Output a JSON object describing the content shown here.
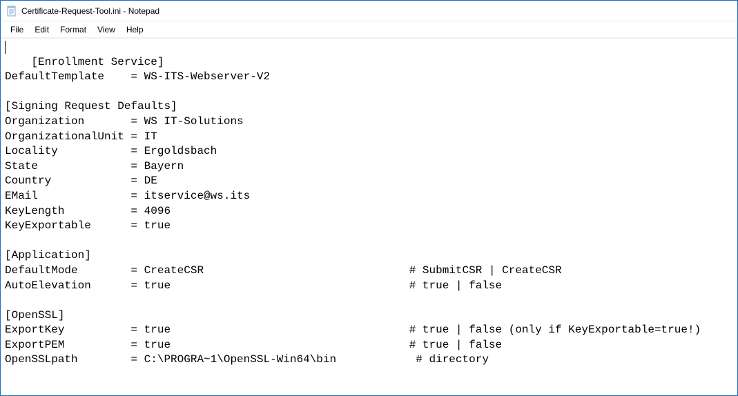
{
  "window": {
    "title": "Certificate-Request-Tool.ini - Notepad"
  },
  "menu": {
    "file": "File",
    "edit": "Edit",
    "format": "Format",
    "view": "View",
    "help": "Help"
  },
  "content": "[Enrollment Service]\nDefaultTemplate    = WS-ITS-Webserver-V2\n\n[Signing Request Defaults]\nOrganization       = WS IT-Solutions\nOrganizationalUnit = IT\nLocality           = Ergoldsbach\nState              = Bayern\nCountry            = DE\nEMail              = itservice@ws.its\nKeyLength          = 4096\nKeyExportable      = true\n\n[Application]\nDefaultMode        = CreateCSR                               # SubmitCSR | CreateCSR\nAutoElevation      = true                                    # true | false\n\n[OpenSSL]\nExportKey          = true                                    # true | false (only if KeyExportable=true!)\nExportPEM          = true                                    # true | false\nOpenSSLpath        = C:\\PROGRA~1\\OpenSSL-Win64\\bin            # directory"
}
